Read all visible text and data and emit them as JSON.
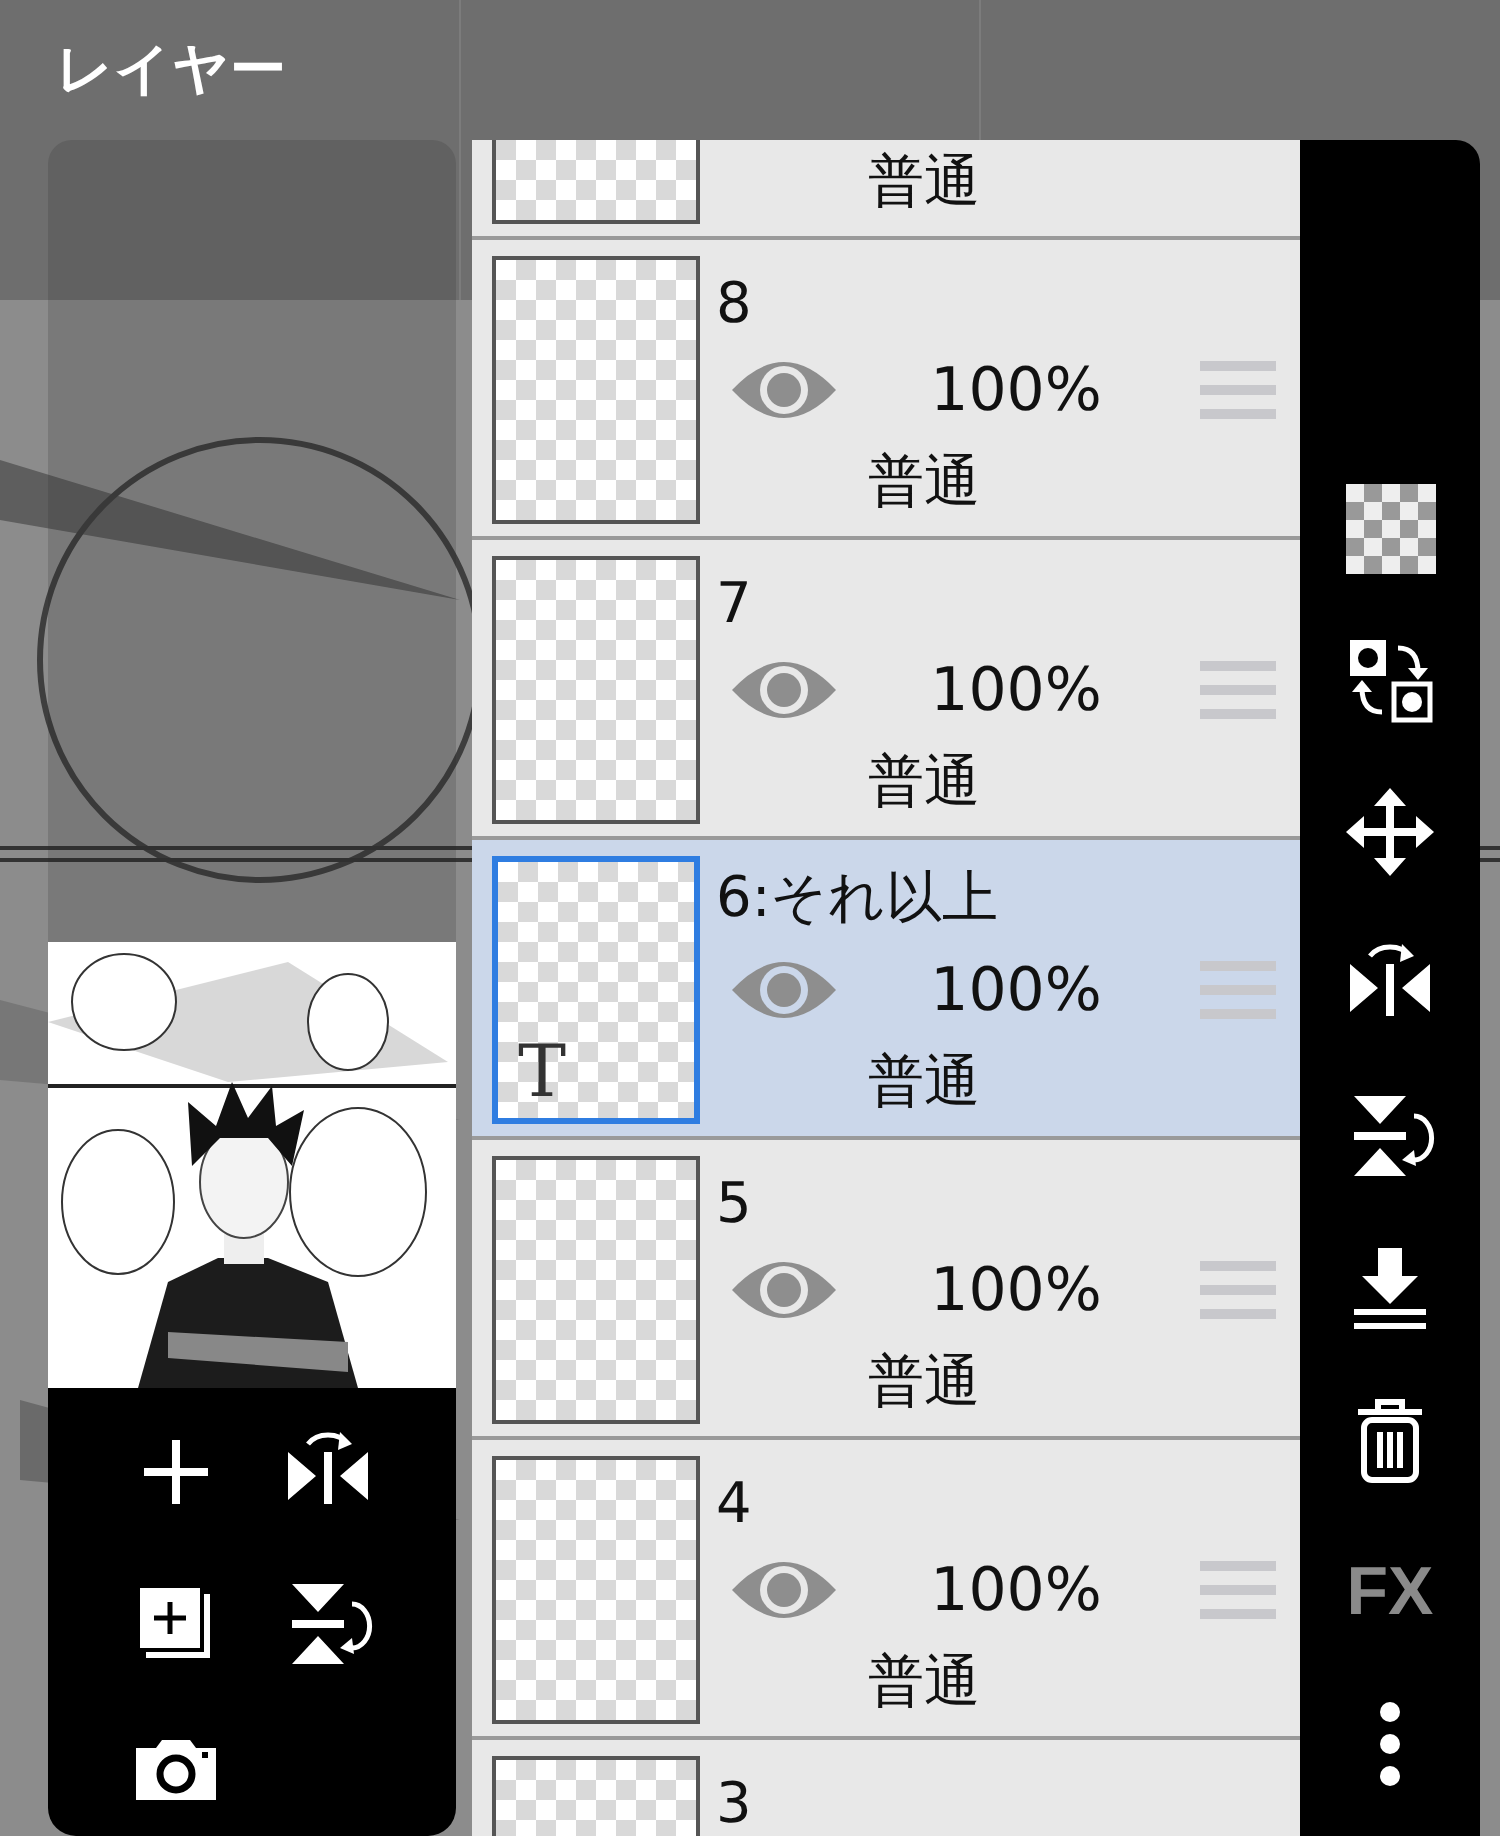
{
  "title": "レイヤー",
  "left_tools": [
    {
      "kind": "add"
    },
    {
      "kind": "flip_horizontal"
    },
    {
      "kind": "add_layer"
    },
    {
      "kind": "flip_vertical"
    },
    {
      "kind": "camera"
    }
  ],
  "layers": [
    {
      "blend": "普通",
      "selected": false
    },
    {
      "name": "8",
      "visible": true,
      "opacity": "100%",
      "blend": "普通",
      "selected": false
    },
    {
      "name": "7",
      "visible": true,
      "opacity": "100%",
      "blend": "普通",
      "selected": false
    },
    {
      "name": "6:それ以上",
      "visible": true,
      "opacity": "100%",
      "blend": "普通",
      "selected": true,
      "badge": "T"
    },
    {
      "name": "5",
      "visible": true,
      "opacity": "100%",
      "blend": "普通",
      "selected": false
    },
    {
      "name": "4",
      "visible": true,
      "opacity": "100%",
      "blend": "普通",
      "selected": false
    },
    {
      "name": "3",
      "selected": false
    }
  ],
  "right_tools": [
    {
      "kind": "checkerboard"
    },
    {
      "kind": "swap"
    },
    {
      "kind": "move"
    },
    {
      "kind": "flip_horizontal"
    },
    {
      "kind": "flip_vertical"
    },
    {
      "kind": "merge_down"
    },
    {
      "kind": "trash"
    },
    {
      "kind": "fx",
      "label": "FX"
    },
    {
      "kind": "more"
    }
  ]
}
